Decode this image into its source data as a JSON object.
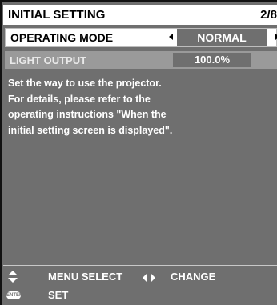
{
  "header": {
    "title": "INITIAL SETTING",
    "page": "2/8"
  },
  "operating_mode": {
    "label": "OPERATING MODE",
    "value": "NORMAL"
  },
  "light_output": {
    "label": "LIGHT OUTPUT",
    "value": "100.0%"
  },
  "description": [
    "Set the way to use the projector.",
    "For details, please refer to the",
    "operating instructions \"When the",
    "initial setting screen is displayed\"."
  ],
  "footer": {
    "menu_select": "MENU SELECT",
    "change": "CHANGE",
    "enter_icon_text": "ENTER",
    "set": "SET"
  },
  "colors": {
    "panel": "#6f6f6f",
    "title_bg": "#ffffff",
    "disabled_row": "#9a9a9a"
  },
  "icons": [
    "up-down-arrows-icon",
    "left-right-arrows-icon",
    "enter-button-icon"
  ]
}
